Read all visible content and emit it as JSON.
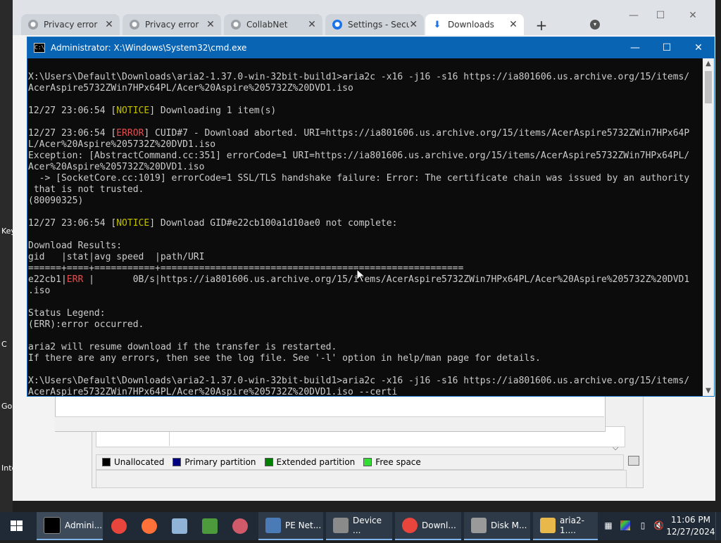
{
  "desktop": {
    "fragments": [
      "Key",
      "C",
      "Go",
      "Inte"
    ]
  },
  "browser": {
    "tabs": [
      {
        "label": "Privacy error",
        "close": "✕",
        "active": false
      },
      {
        "label": "Privacy error",
        "close": "✕",
        "active": false
      },
      {
        "label": "CollabNet",
        "close": "✕",
        "active": false
      },
      {
        "label": "Settings - Secu",
        "close": "✕",
        "active": false
      },
      {
        "label": "Downloads",
        "close": "✕",
        "active": true
      }
    ],
    "new_tab": "+",
    "controls": {
      "minimize": "—",
      "maximize": "☐",
      "close": "✕"
    }
  },
  "cmd": {
    "title": "Administrator: X:\\Windows\\System32\\cmd.exe",
    "controls": {
      "minimize": "—",
      "maximize": "☐",
      "close": "✕"
    },
    "lines": [
      "X:\\Users\\Default\\Downloads\\aria2-1.37.0-win-32bit-build1>aria2c -x16 -j16 -s16 https://ia801606.us.archive.org/15/items/",
      "AcerAspire5732ZWin7HPx64PL/Acer%20Aspire%205732Z%20DVD1.iso",
      "",
      [
        "12/27 23:06:54 [",
        {
          "c": "yellow",
          "t": "NOTICE"
        },
        "] Downloading 1 item(s)"
      ],
      "",
      [
        "12/27 23:06:54 [",
        {
          "c": "red",
          "t": "ERROR"
        },
        "] CUID#7 - Download aborted. URI=https://ia801606.us.archive.org/15/items/AcerAspire5732ZWin7HPx64P"
      ],
      "L/Acer%20Aspire%205732Z%20DVD1.iso",
      "Exception: [AbstractCommand.cc:351] errorCode=1 URI=https://ia801606.us.archive.org/15/items/AcerAspire5732ZWin7HPx64PL/",
      "Acer%20Aspire%205732Z%20DVD1.iso",
      "  -> [SocketCore.cc:1019] errorCode=1 SSL/TLS handshake failure: Error: The certificate chain was issued by an authority",
      " that is not trusted.",
      "(80090325)",
      "",
      [
        "12/27 23:06:54 [",
        {
          "c": "yellow",
          "t": "NOTICE"
        },
        "] Download GID#e22cb100a1d10ae0 not complete:"
      ],
      "",
      "Download Results:",
      "gid   |stat|avg speed  |path/URI",
      "======+====+===========+=======================================================",
      [
        "e22cb1|",
        {
          "c": "red",
          "t": "ERR "
        },
        "|       0B/s|https://ia801606.us.archive.org/15/items/AcerAspire5732ZWin7HPx64PL/Acer%20Aspire%205732Z%20DVD1"
      ],
      ".iso",
      "",
      "Status Legend:",
      "(ERR):error occurred.",
      "",
      "aria2 will resume download if the transfer is restarted.",
      "If there are any errors, then see the log file. See '-l' option in help/man page for details.",
      "",
      "X:\\Users\\Default\\Downloads\\aria2-1.37.0-win-32bit-build1>aria2c -x16 -j16 -s16 https://ia801606.us.archive.org/15/items/",
      "AcerAspire5732ZWin7HPx64PL/Acer%20Aspire%205732Z%20DVD1.iso --certi"
    ]
  },
  "disk_management": {
    "legend": [
      {
        "label": "Unallocated",
        "color": "#000000"
      },
      {
        "label": "Primary partition",
        "color": "#000080"
      },
      {
        "label": "Extended partition",
        "color": "#008000"
      },
      {
        "label": "Free space",
        "color": "#33dd33"
      }
    ]
  },
  "taskbar": {
    "start_icon": "windows-start-icon",
    "items": [
      {
        "label": "Admini...",
        "icon": "cmd-icon",
        "color": "#000000",
        "active": true
      },
      {
        "label": "PE Net...",
        "icon": "network-icon",
        "color": "#4a7bb7"
      },
      {
        "label": "Device ...",
        "icon": "device-manager-icon",
        "color": "#8a8a8a"
      },
      {
        "label": "Downl...",
        "icon": "chrome-icon",
        "color": "#e8453c"
      },
      {
        "label": "Disk M...",
        "icon": "disk-icon",
        "color": "#9a9a9a"
      },
      {
        "label": "aria2-1....",
        "icon": "folder-icon",
        "color": "#e8b84a"
      }
    ],
    "pinned": [
      {
        "icon": "chrome-pinned-icon",
        "color": "#e8453c"
      },
      {
        "icon": "firefox-icon",
        "color": "#ff7139"
      },
      {
        "icon": "notepad-icon",
        "color": "#8fb4d8"
      },
      {
        "icon": "spreadsheet-icon",
        "color": "#4c9a3c"
      },
      {
        "icon": "paint-icon",
        "color": "#d05a6a"
      }
    ],
    "clock": {
      "time": "11:06 PM",
      "date": "12/27/2024"
    }
  }
}
